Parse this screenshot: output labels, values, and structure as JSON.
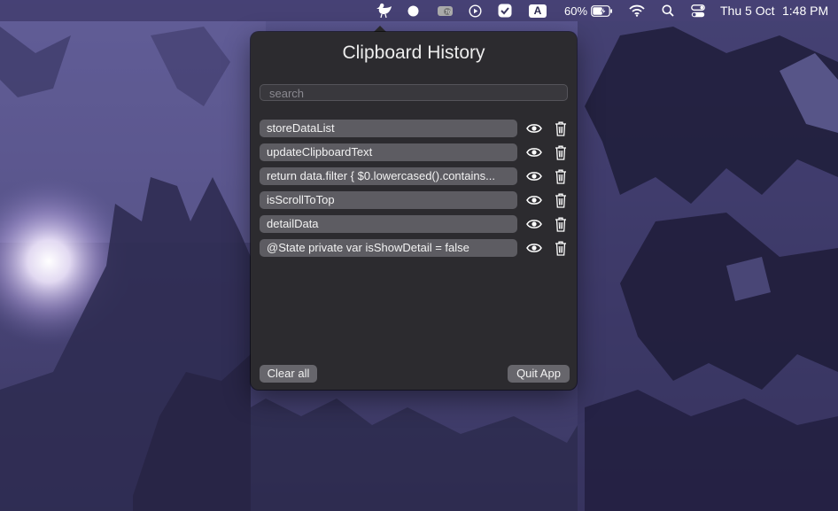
{
  "menubar": {
    "battery_percent": "60%",
    "date": "Thu 5 Oct",
    "time": "1:48 PM",
    "input_source": "A",
    "icons": [
      "duck-app-icon",
      "record-icon",
      "ps-icon",
      "play-icon",
      "check-icon",
      "input-source-icon",
      "battery-icon",
      "wifi-icon",
      "search-icon",
      "control-center-icon"
    ]
  },
  "popover": {
    "title": "Clipboard History",
    "search": {
      "placeholder": "search",
      "value": ""
    },
    "items": [
      {
        "text": "storeDataList"
      },
      {
        "text": "updateClipboardText"
      },
      {
        "text": "return data.filter { $0.lowercased().contains..."
      },
      {
        "text": "isScrollToTop"
      },
      {
        "text": "detailData"
      },
      {
        "text": "@State private var isShowDetail = false"
      }
    ],
    "clear_label": "Clear all",
    "quit_label": "Quit App"
  },
  "colors": {
    "popover_bg": "#2c2b2f",
    "pill_bg": "#5d5c62",
    "button_bg": "#67666c",
    "wallpaper": "#4a4878"
  }
}
